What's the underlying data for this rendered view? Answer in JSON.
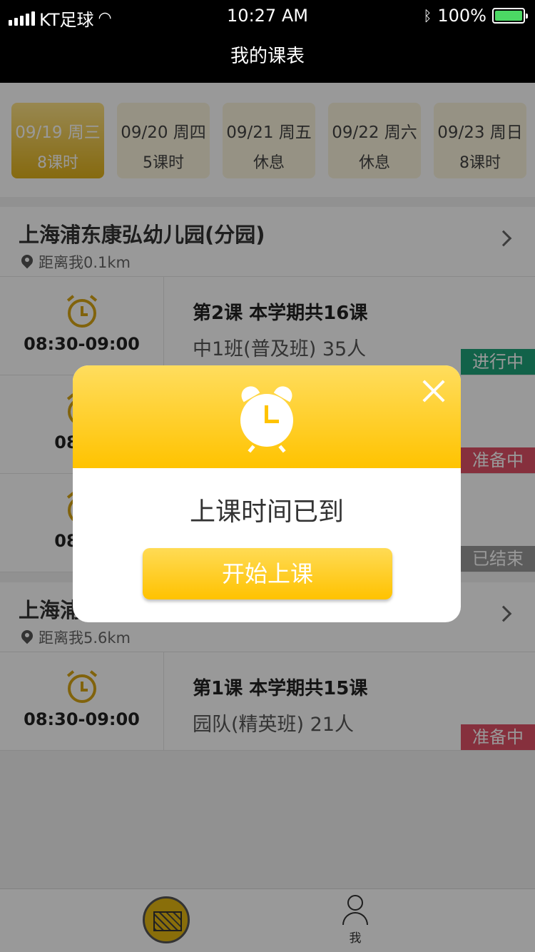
{
  "status": {
    "carrier": "KT足球",
    "time": "10:27 AM",
    "battery": "100%"
  },
  "nav": {
    "title": "我的课表"
  },
  "dates": [
    {
      "date": "09/19 周三",
      "count": "8课时",
      "active": true
    },
    {
      "date": "09/20 周四",
      "count": "5课时",
      "active": false
    },
    {
      "date": "09/21 周五",
      "count": "休息",
      "active": false
    },
    {
      "date": "09/22 周六",
      "count": "休息",
      "active": false
    },
    {
      "date": "09/23 周日",
      "count": "8课时",
      "active": false
    }
  ],
  "schools": [
    {
      "name": "上海浦东康弘幼儿园(分园)",
      "distance": "距离我0.1km",
      "lessons": [
        {
          "time": "08:30-09:00",
          "title": "第2课  本学期共16课",
          "sub": "中1班(普及班)  35人",
          "status": "进行中",
          "status_color": "#1fa37a"
        },
        {
          "time": "08:30",
          "title": "",
          "sub": "",
          "status": "准备中",
          "status_color": "#e05066"
        },
        {
          "time": "08:30",
          "title": "",
          "sub": "",
          "status": "已结束",
          "status_color": "#9a9a9a"
        }
      ]
    },
    {
      "name": "上海浦",
      "distance": "距离我5.6km",
      "lessons": [
        {
          "time": "08:30-09:00",
          "title": "第1课  本学期共15课",
          "sub": "园队(精英班)  21人",
          "status": "准备中",
          "status_color": "#e05066"
        }
      ]
    }
  ],
  "tabbar": {
    "me_label": "我"
  },
  "modal": {
    "message": "上课时间已到",
    "button": "开始上课",
    "icon": "alarm-clock-icon"
  }
}
